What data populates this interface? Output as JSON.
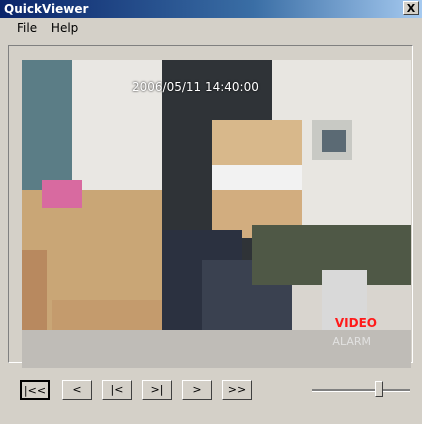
{
  "window": {
    "title": "QuickViewer",
    "close_label": "X"
  },
  "menu": {
    "items": [
      "File",
      "Help"
    ]
  },
  "video": {
    "timestamp": "2006/05/11 14:40:00",
    "overlay_label": "VIDEO",
    "overlay_sublabel": "ALARM"
  },
  "controls": {
    "buttons": [
      "|<<",
      "<",
      "|<",
      ">|",
      ">",
      ">>"
    ]
  },
  "slider": {
    "value": 0.68
  }
}
